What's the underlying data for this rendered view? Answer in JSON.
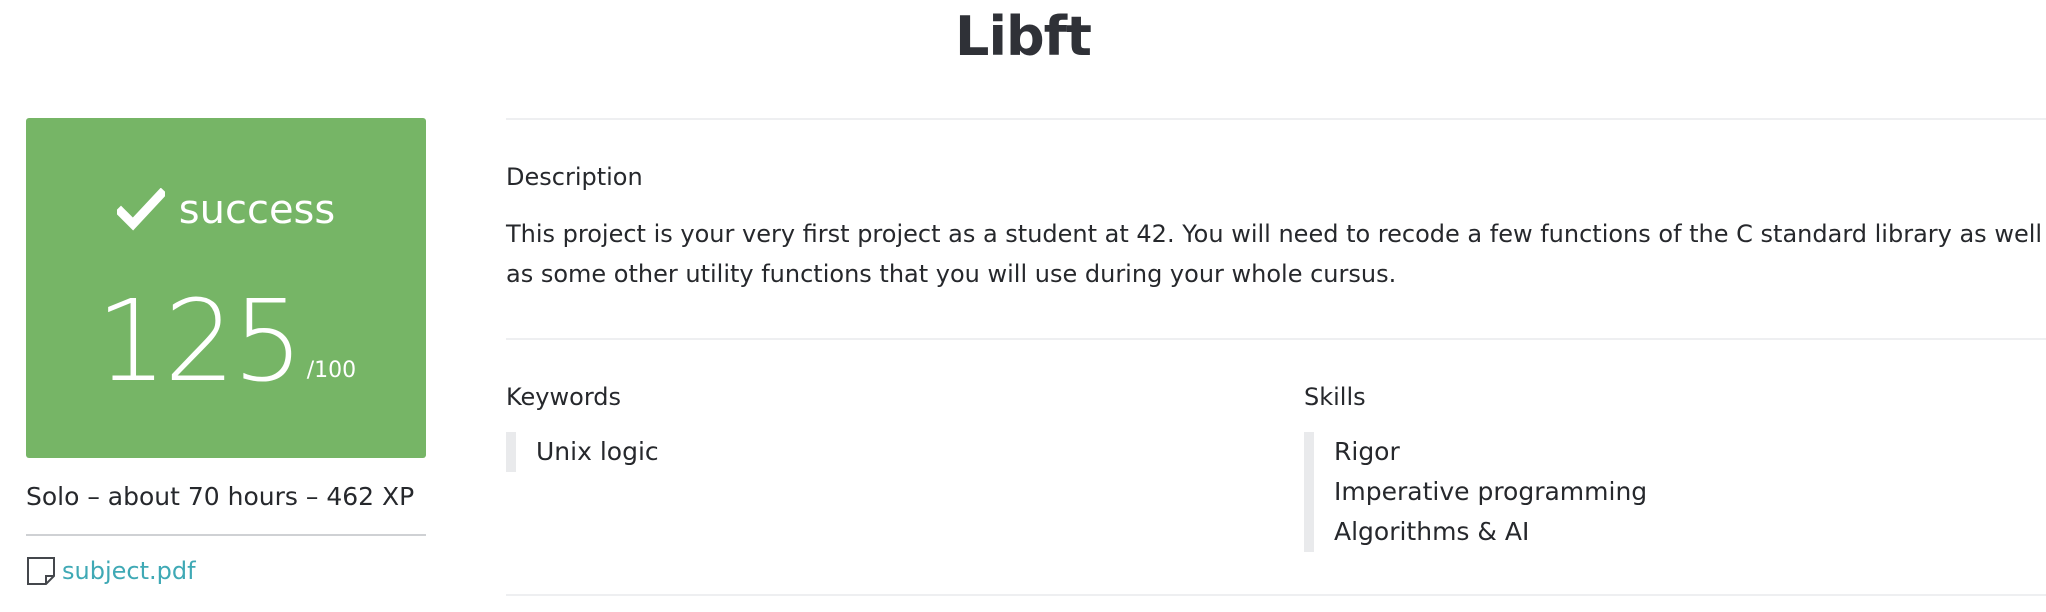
{
  "page": {
    "title": "Libft"
  },
  "grade": {
    "status": "success",
    "score": "125",
    "max": "/100",
    "color": "#76b566",
    "status_icon": "check-icon"
  },
  "project_meta": "Solo – about 70 hours – 462 XP",
  "attachment": {
    "icon": "file-icon",
    "label": "subject.pdf",
    "link_color": "#3fa9b5"
  },
  "description": {
    "label": "Description",
    "text": "This project is your very first project as a student at 42. You will need to recode a few functions of the C standard library as well as some other utility functions that you will use during your whole cursus."
  },
  "keywords": {
    "label": "Keywords",
    "items": [
      "Unix logic"
    ]
  },
  "skills": {
    "label": "Skills",
    "items": [
      "Rigor",
      "Imperative programming",
      "Algorithms & AI"
    ]
  }
}
